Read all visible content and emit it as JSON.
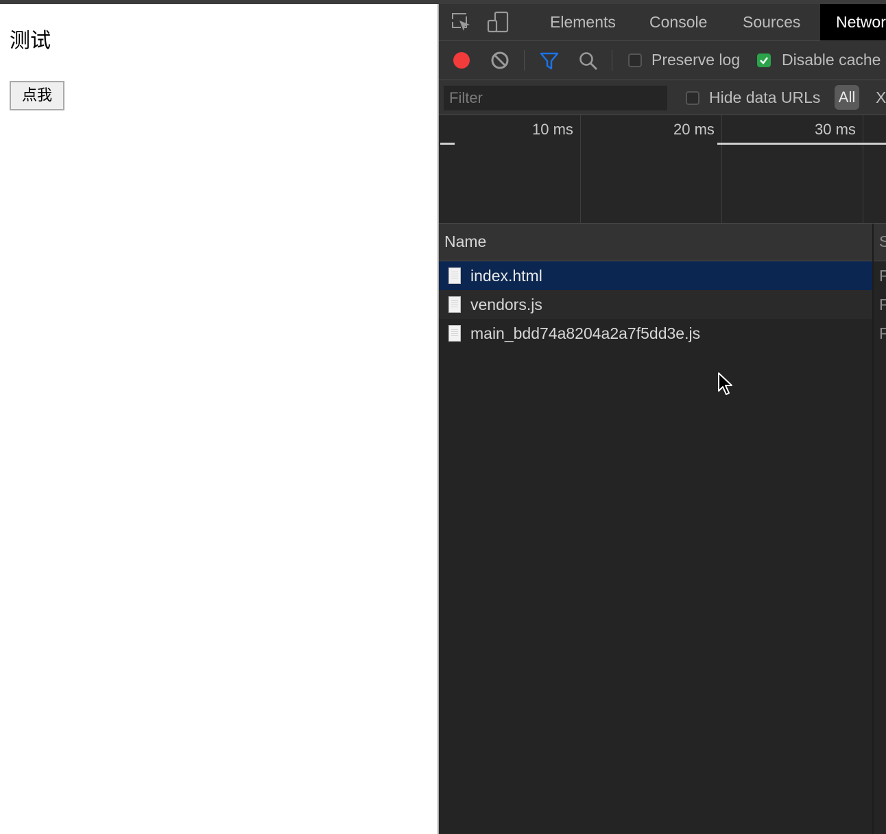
{
  "page": {
    "heading": "测试",
    "button_label": "点我"
  },
  "devtools": {
    "tabs": [
      {
        "label": "Elements"
      },
      {
        "label": "Console"
      },
      {
        "label": "Sources"
      },
      {
        "label": "Network"
      }
    ],
    "active_tab": "Network",
    "toolbar": {
      "preserve_log_label": "Preserve log",
      "preserve_log_checked": false,
      "disable_cache_label": "Disable cache",
      "disable_cache_checked": true
    },
    "filter": {
      "placeholder": "Filter",
      "hide_data_urls_label": "Hide data URLs",
      "all_label": "All",
      "xhr_label": "X"
    },
    "timeline": {
      "ticks": [
        "10 ms",
        "20 ms",
        "30 ms"
      ]
    },
    "table": {
      "name_header": "Name",
      "next_header": "S",
      "next_col_value": "F",
      "rows": [
        {
          "name": "index.html"
        },
        {
          "name": "vendors.js"
        },
        {
          "name": "main_bdd74a8204a2a7f5dd3e.js"
        }
      ]
    },
    "colors": {
      "record": "#f23b3b",
      "filter_icon": "#1a73e8",
      "selected_row": "#0b2650",
      "checkbox_on": "#2aa34a"
    }
  }
}
